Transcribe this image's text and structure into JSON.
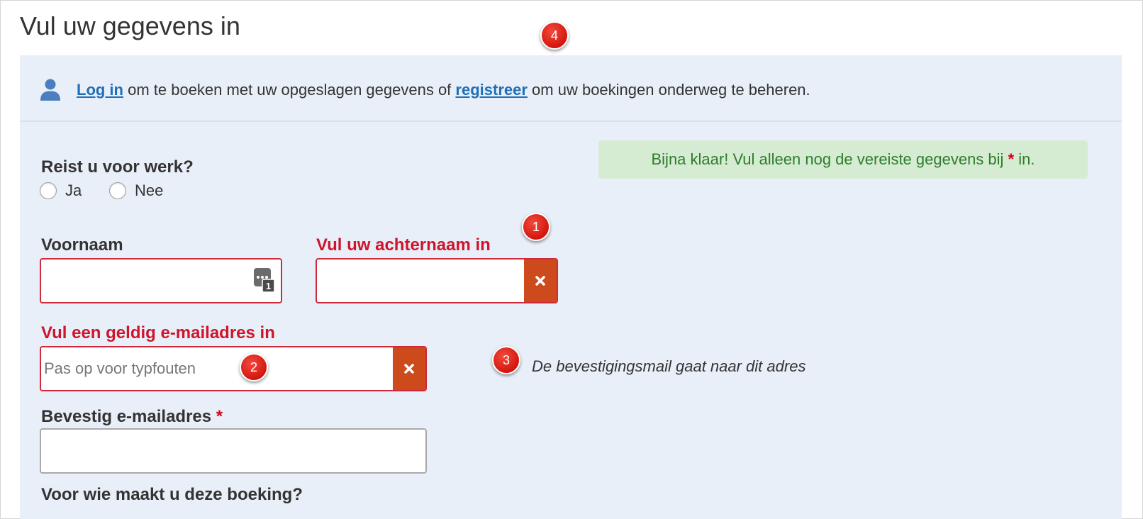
{
  "page": {
    "title": "Vul uw gegevens in"
  },
  "login_bar": {
    "icon": "user-icon",
    "login_link": "Log in",
    "text_1": " om te boeken met uw opgeslagen gegevens of ",
    "register_link": "registreer",
    "text_2": " om uw boekingen onderweg te beheren.",
    "link_color": "#1f6fb8"
  },
  "alert": {
    "text_1": "Bijna klaar! Vul alleen nog de vereiste gegevens bij ",
    "asterisk": "*",
    "text_2": " in.",
    "background": "#d6ecd2",
    "color": "#2d7d2d"
  },
  "business_travel": {
    "question": "Reist u voor werk?",
    "options": [
      "Ja",
      "Nee"
    ],
    "selected": null
  },
  "first_name": {
    "label": "Voornaam",
    "value": "",
    "icon": "password-manager-icon"
  },
  "last_name": {
    "error_label": "Vul uw achternaam in",
    "value": "",
    "error_icon": "error-x-icon"
  },
  "email": {
    "error_label": "Vul een geldig e-mailadres in",
    "placeholder": "Pas op voor typfouten",
    "value": "",
    "hint": "De bevestigingsmail gaat naar dit adres",
    "error_icon": "error-x-icon"
  },
  "confirm_email": {
    "label": "Bevestig e-mailadres",
    "required_marker": "*",
    "value": ""
  },
  "booking_for": {
    "label": "Voor wie maakt u deze boeking?"
  },
  "annotations": [
    "1",
    "2",
    "3",
    "4"
  ],
  "colors": {
    "panel_background": "#e9eff8",
    "error_red": "#d0142c",
    "error_addon": "#cc4a1c",
    "badge_red": "#d4160d"
  }
}
